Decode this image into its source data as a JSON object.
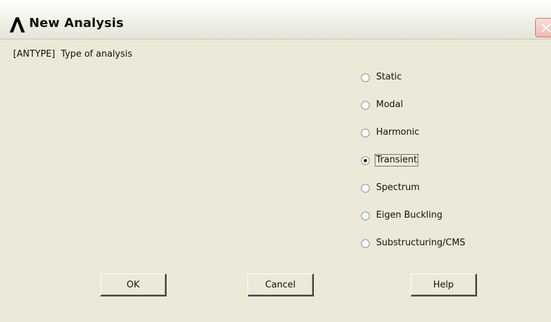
{
  "window": {
    "title": "New Analysis"
  },
  "analysis": {
    "label": "[ANTYPE]  Type of analysis",
    "options": [
      {
        "label": "Static",
        "selected": false
      },
      {
        "label": "Modal",
        "selected": false
      },
      {
        "label": "Harmonic",
        "selected": false
      },
      {
        "label": "Transient",
        "selected": true
      },
      {
        "label": "Spectrum",
        "selected": false
      },
      {
        "label": "Eigen Buckling",
        "selected": false
      },
      {
        "label": "Substructuring/CMS",
        "selected": false
      }
    ]
  },
  "buttons": {
    "ok": "OK",
    "cancel": "Cancel",
    "help": "Help"
  },
  "icons": {
    "logo": "ansys-logo-icon",
    "close": "close-icon"
  },
  "colors": {
    "background": "#ece9d8",
    "close_button": "#eebcb0",
    "logo": "#000000"
  }
}
